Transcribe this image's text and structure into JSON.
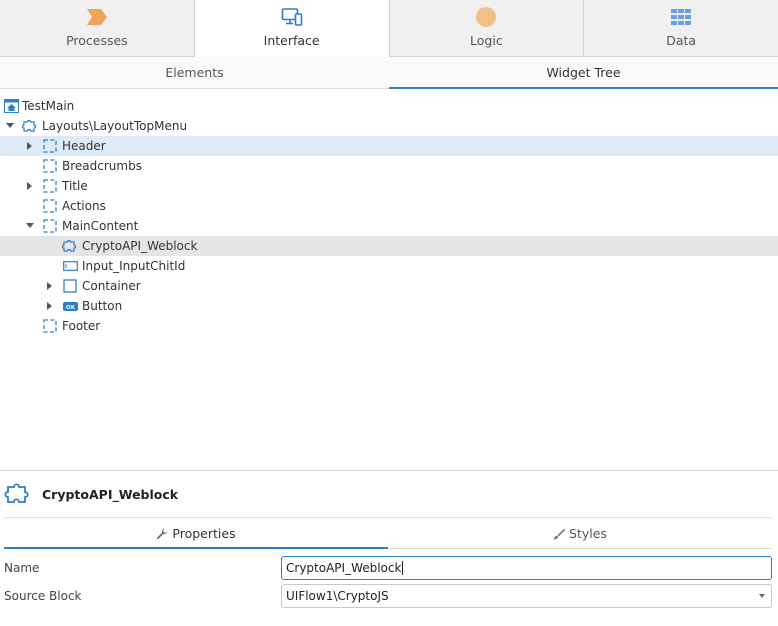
{
  "top_tabs": [
    {
      "label": "Processes",
      "icon": "processes-chevron-icon",
      "active": false
    },
    {
      "label": "Interface",
      "icon": "monitor-devices-icon",
      "active": true
    },
    {
      "label": "Logic",
      "icon": "logic-circle-icon",
      "active": false
    },
    {
      "label": "Data",
      "icon": "data-grid-icon",
      "active": false
    }
  ],
  "sub_tabs": [
    {
      "label": "Elements",
      "active": false
    },
    {
      "label": "Widget Tree",
      "active": true
    }
  ],
  "tree": [
    {
      "label": "TestMain",
      "icon": "home-screen-icon",
      "caret": "none",
      "state": ""
    },
    {
      "label": "Layouts\\LayoutTopMenu",
      "icon": "puzzle-block-icon",
      "caret": "down",
      "state": ""
    },
    {
      "label": "Header",
      "icon": "placeholder-dashed-icon",
      "caret": "right",
      "state": "selected"
    },
    {
      "label": "Breadcrumbs",
      "icon": "placeholder-dashed-icon",
      "caret": "none",
      "state": ""
    },
    {
      "label": "Title",
      "icon": "placeholder-dashed-icon",
      "caret": "right",
      "state": ""
    },
    {
      "label": "Actions",
      "icon": "placeholder-dashed-icon",
      "caret": "none",
      "state": ""
    },
    {
      "label": "MainContent",
      "icon": "placeholder-dashed-icon",
      "caret": "down",
      "state": ""
    },
    {
      "label": "CryptoAPI_Weblock",
      "icon": "puzzle-block-icon",
      "caret": "none",
      "state": "hover"
    },
    {
      "label": "Input_InputChitId",
      "icon": "input-field-icon",
      "caret": "none",
      "state": ""
    },
    {
      "label": "Container",
      "icon": "container-square-icon",
      "caret": "right",
      "state": ""
    },
    {
      "label": "Button",
      "icon": "ok-button-icon",
      "caret": "right",
      "state": ""
    },
    {
      "label": "Footer",
      "icon": "placeholder-dashed-icon",
      "caret": "none",
      "state": ""
    }
  ],
  "button_icon_text": "OK",
  "panel": {
    "title": "CryptoAPI_Weblock",
    "icon": "puzzle-block-icon"
  },
  "prop_tabs": [
    {
      "label": "Properties",
      "icon": "wrench-icon",
      "active": true
    },
    {
      "label": "Styles",
      "icon": "brush-icon",
      "active": false
    }
  ],
  "fields": {
    "name_label": "Name",
    "name_value": "CryptoAPI_Weblock",
    "source_label": "Source Block",
    "source_value": "UIFlow1\\CryptoJS"
  },
  "colors": {
    "accent": "#2f7fc7",
    "processes": "#f0a35a",
    "logic": "#f0c08a",
    "data": "#6b9fe0",
    "selected_row": "#dfeaf7",
    "hover_row": "#e5e5e5"
  }
}
